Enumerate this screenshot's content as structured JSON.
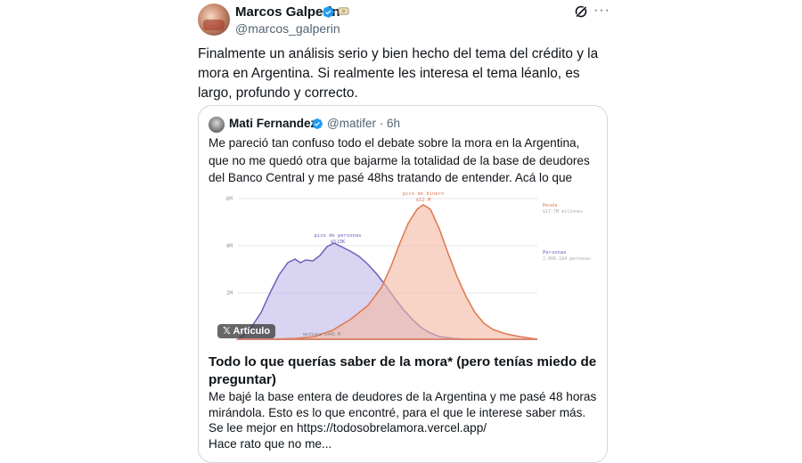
{
  "author": {
    "name": "Marcos Galperin",
    "handle": "@marcos_galperin",
    "icons": [
      "verified-badge-icon",
      "affiliate-badge-icon"
    ]
  },
  "actions": {
    "grok_icon": "grok-icon",
    "more_label": "···"
  },
  "tweet_text": "Finalmente un análisis serio y bien hecho del tema del crédito y la mora en Argentina. Si realmente les interesa el tema léanlo, es largo, profundo y correcto.",
  "quoted": {
    "name": "Mati Fernandez",
    "handle_time": "@matifer · 6h",
    "text": "Me pareció tan confuso todo el debate sobre la mora en la Argentina, que no me quedó otra que bajarme la totalidad de la base de deudores del Banco Central y me pasé 48hs tratando de entender. Acá lo que encontré:",
    "badge": "Artículo",
    "card_title": "Todo lo que querías saber de la mora* (pero tenías miedo de preguntar)",
    "card_description": "Me bajé la base entera de deudores de la Argentina y me pasé 48 horas mirándola. Esto es lo que encontré, para el que le interese saber más. Se lee mejor en https://todosobrelamora.vercel.app/\nHace rato que no me...",
    "chart": {
      "peak_people_label": "pico de personas",
      "peak_people_value": "$513K",
      "peak_money_label": "pico de dinero",
      "peak_money_value": "$12 M",
      "legend_debt_title": "Deuda",
      "legend_debt_sub": "$17.7M millones",
      "legend_people_title": "Personas",
      "legend_people_sub": "2.000.184 personas",
      "median_label": "mediana $445 M",
      "ytick_top": "6M",
      "ytick_mid": "4M",
      "ytick_low": "2M",
      "colors": {
        "people": "#7b6fc4",
        "money": "#e8896a"
      }
    }
  }
}
